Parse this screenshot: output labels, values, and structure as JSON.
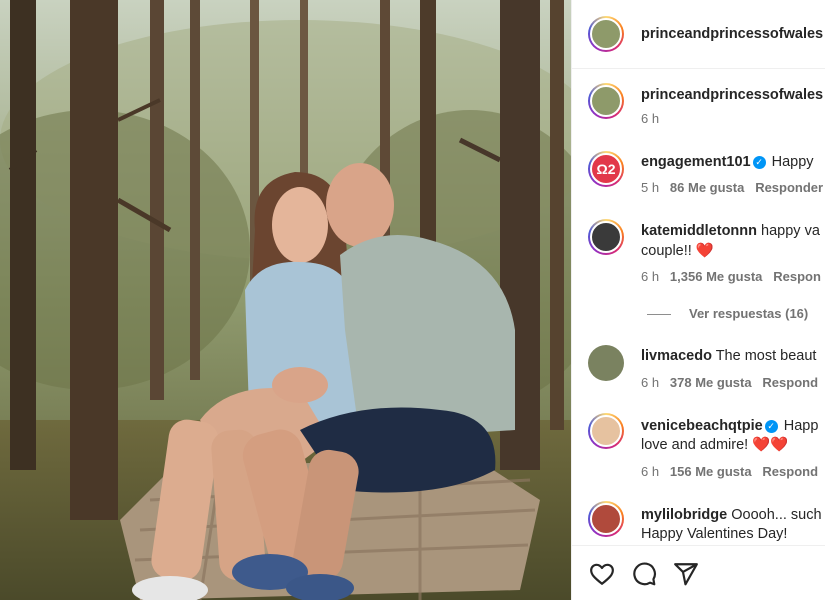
{
  "post": {
    "account": "princeandprincessofwales",
    "caption_time": "6 h"
  },
  "comments": [
    {
      "user": "engagement101",
      "verified": true,
      "lines": [
        "Happy"
      ],
      "time": "5 h",
      "likes": "86 Me gusta",
      "reply": "Responder"
    },
    {
      "user": "katemiddletonnn",
      "verified": false,
      "lines": [
        "happy va",
        "couple!! ❤️"
      ],
      "time": "6 h",
      "likes": "1,356 Me gusta",
      "reply": "Respon",
      "view_replies": "Ver respuestas (16)"
    },
    {
      "user": "livmacedo",
      "verified": false,
      "lines": [
        "The most beaut"
      ],
      "time": "6 h",
      "likes": "378 Me gusta",
      "reply": "Respond"
    },
    {
      "user": "venicebeachqtpie",
      "verified": true,
      "lines": [
        "Happ",
        "love and admire! ❤️❤️"
      ],
      "time": "6 h",
      "likes": "156 Me gusta",
      "reply": "Respond"
    },
    {
      "user": "mylilobridge",
      "verified": false,
      "lines": [
        "Ooooh... such",
        "Happy Valentines Day!"
      ]
    }
  ],
  "colors": {
    "verified": "#0095f6",
    "text": "#262626",
    "muted": "#737373",
    "heart": "#ed4956"
  },
  "icons": [
    "heart-outline-icon",
    "comment-icon",
    "share-icon",
    "verified-badge-icon"
  ]
}
